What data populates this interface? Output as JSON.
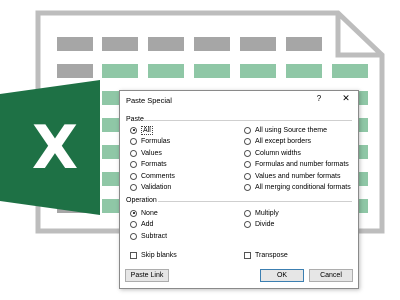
{
  "dialog": {
    "title": "Paste Special",
    "help_label": "?",
    "close_label": "✕",
    "paste_section": "Paste",
    "paste_left": [
      {
        "label": "All",
        "selected": true
      },
      {
        "label": "Formulas",
        "selected": false
      },
      {
        "label": "Values",
        "selected": false
      },
      {
        "label": "Formats",
        "selected": false
      },
      {
        "label": "Comments",
        "selected": false
      },
      {
        "label": "Validation",
        "selected": false
      }
    ],
    "paste_right": [
      {
        "label": "All using Source theme",
        "selected": false
      },
      {
        "label": "All except borders",
        "selected": false
      },
      {
        "label": "Column widths",
        "selected": false
      },
      {
        "label": "Formulas and number formats",
        "selected": false
      },
      {
        "label": "Values and number formats",
        "selected": false
      },
      {
        "label": "All merging conditional formats",
        "selected": false
      }
    ],
    "operation_section": "Operation",
    "operation_left": [
      {
        "label": "None",
        "selected": true
      },
      {
        "label": "Add",
        "selected": false
      },
      {
        "label": "Subtract",
        "selected": false
      }
    ],
    "operation_right": [
      {
        "label": "Multiply",
        "selected": false
      },
      {
        "label": "Divide",
        "selected": false
      }
    ],
    "skip_blanks_label": "Skip blanks",
    "transpose_label": "Transpose",
    "paste_link_label": "Paste Link",
    "ok_label": "OK",
    "cancel_label": "Cancel"
  },
  "logo": {
    "letter": "X"
  },
  "colors": {
    "excel_green": "#1e7145",
    "excel_green_dark": "#185c38",
    "cell_gray": "#a6a6a6",
    "cell_green": "#8fc7a6",
    "doc_border": "#bdbdbd"
  }
}
